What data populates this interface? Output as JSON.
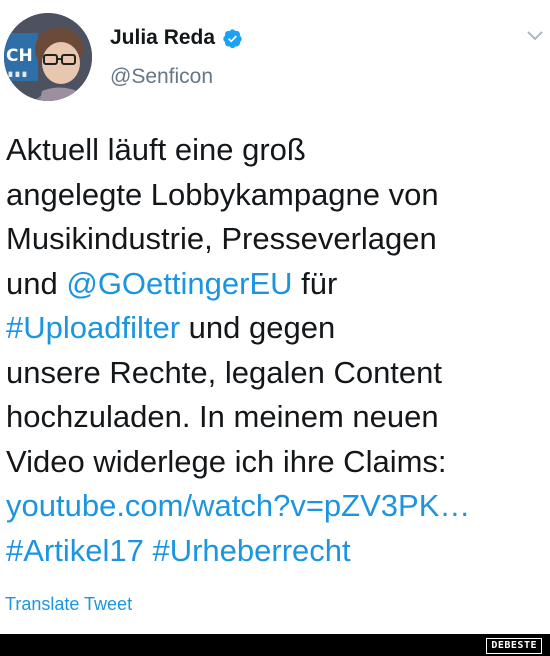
{
  "tweet": {
    "author": {
      "display_name": "Julia Reda",
      "handle": "@Senficon",
      "verified": true
    },
    "lines": [
      [
        {
          "text": "Aktuell läuft eine groß",
          "type": "text"
        }
      ],
      [
        {
          "text": "angelegte Lobbykampagne von",
          "type": "text"
        }
      ],
      [
        {
          "text": "Musikindustrie, Presseverlagen",
          "type": "text"
        }
      ],
      [
        {
          "text": "und ",
          "type": "text"
        },
        {
          "text": "@GOettingerEU",
          "type": "mention"
        },
        {
          "text": " für",
          "type": "text"
        }
      ],
      [
        {
          "text": "#Uploadfilter",
          "type": "hashtag"
        },
        {
          "text": " und gegen",
          "type": "text"
        }
      ],
      [
        {
          "text": "unsere Rechte, legalen Content",
          "type": "text"
        }
      ],
      [
        {
          "text": "hochzuladen. In meinem neuen",
          "type": "text"
        }
      ],
      [
        {
          "text": "Video widerlege ich ihre Claims:",
          "type": "text"
        }
      ],
      [
        {
          "text": "youtube.com/watch?v=pZV3PK…",
          "type": "url"
        }
      ],
      [
        {
          "text": "#Artikel17",
          "type": "hashtag"
        },
        {
          "text": " ",
          "type": "text"
        },
        {
          "text": "#Urheberrecht",
          "type": "hashtag"
        }
      ]
    ],
    "translate_label": "Translate Tweet",
    "menu_icon": "chevron-down-icon",
    "link_color": "#1b95e0",
    "verified_color": "#1da1f2"
  },
  "watermark": "DEBESTE"
}
